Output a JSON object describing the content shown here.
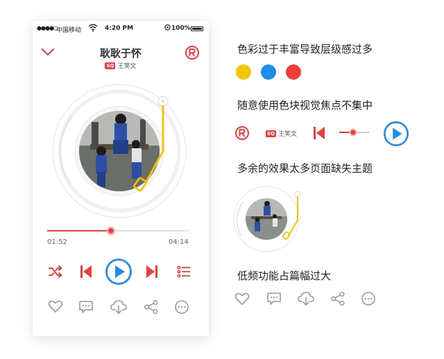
{
  "status_bar": {
    "signal_dots": "●●●●○",
    "carrier": "中国移动",
    "time": "4:20 PM",
    "battery": "100%"
  },
  "player": {
    "song_title": "耿耿于怀",
    "artist": "王笑文",
    "quality_badge": "SQ",
    "elapsed": "01:52",
    "total": "04:14",
    "progress": 0.45
  },
  "annotations": {
    "note_1": "色彩过于丰富导致层级感过多",
    "note_2": "随意使用色块视觉焦点不集中",
    "note_3": "多余的效果太多页面缺失主题",
    "note_4": "低频功能占篇幅过大"
  },
  "colors": {
    "accent_red": "#ee3c3c",
    "accent_blue": "#1a8ff0",
    "accent_yellow": "#f5c400",
    "swatch_1": "#f5c400",
    "swatch_2": "#1a8ff0",
    "swatch_3": "#ee3c3c"
  },
  "icons": {
    "collapse": "chevron-down-icon",
    "brand": "registered-icon",
    "shuffle": "shuffle-icon",
    "prev": "skip-previous-icon",
    "play": "play-icon",
    "next": "skip-next-icon",
    "playlist": "playlist-icon",
    "like": "heart-icon",
    "comment": "comment-icon",
    "download": "cloud-download-icon",
    "share": "share-icon",
    "more": "more-icon"
  }
}
